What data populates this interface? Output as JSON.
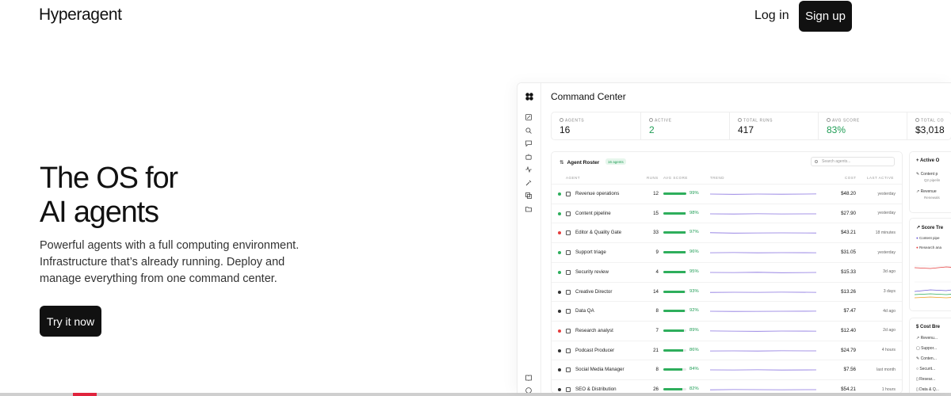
{
  "nav": {
    "logo": "Hyperagent",
    "login": "Log in",
    "signup": "Sign up"
  },
  "hero": {
    "title_lines": [
      "The OS for",
      "AI agents"
    ],
    "subtitle_lines": [
      "Powerful agents with a full computing environment.",
      "Infrastructure that’s already running. Deploy and",
      "manage everything from one command center."
    ],
    "cta": "Try it now"
  },
  "app": {
    "title": "Command Center",
    "stats": [
      {
        "label": "AGENTS",
        "value": "16",
        "color": "#111111"
      },
      {
        "label": "ACTIVE",
        "value": "2",
        "color": "#1f9d55"
      },
      {
        "label": "TOTAL RUNS",
        "value": "417",
        "color": "#111111"
      },
      {
        "label": "AVG SCORE",
        "value": "83%",
        "color": "#1f9d55"
      },
      {
        "label": "TOTAL CO",
        "value": "$3,018",
        "color": "#111111"
      }
    ],
    "roster": {
      "title": "Agent Roster",
      "badge": "16 agents",
      "search_placeholder": "Search agents...",
      "columns": [
        "AGENT",
        "RUNS",
        "AVG SCORE",
        "TREND",
        "COST",
        "LAST ACTIVE"
      ],
      "rows": [
        {
          "name": "Revenue operations",
          "runs": "12",
          "score": 99,
          "score_label": "99%",
          "cost": "$48.20",
          "last": "yesterday",
          "status": "#2eae5c",
          "icon": "trend-icon"
        },
        {
          "name": "Content pipeline",
          "runs": "15",
          "score": 98,
          "score_label": "98%",
          "cost": "$27.90",
          "last": "yesterday",
          "status": "#2eae5c",
          "icon": "pencil-icon"
        },
        {
          "name": "Editor & Quality Gate",
          "runs": "33",
          "score": 97,
          "score_label": "97%",
          "cost": "$43.21",
          "last": "18 minutes",
          "status": "#e53e3e",
          "icon": "search-icon"
        },
        {
          "name": "Support triage",
          "runs": "9",
          "score": 96,
          "score_label": "96%",
          "cost": "$31.05",
          "last": "yesterday",
          "status": "#2eae5c",
          "icon": "chat-icon"
        },
        {
          "name": "Security review",
          "runs": "4",
          "score": 95,
          "score_label": "95%",
          "cost": "$15.33",
          "last": "3d ago",
          "status": "#2eae5c",
          "icon": "shield-icon"
        },
        {
          "name": "Creative Director",
          "runs": "14",
          "score": 93,
          "score_label": "93%",
          "cost": "$13.26",
          "last": "3 days",
          "status": "#333333",
          "icon": "chart-icon"
        },
        {
          "name": "Data QA",
          "runs": "8",
          "score": 92,
          "score_label": "92%",
          "cost": "$7.47",
          "last": "4d ago",
          "status": "#333333",
          "icon": "chart-icon"
        },
        {
          "name": "Research analyst",
          "runs": "7",
          "score": 89,
          "score_label": "89%",
          "cost": "$12.40",
          "last": "2d ago",
          "status": "#e53e3e",
          "icon": "chart-icon"
        },
        {
          "name": "Podcast Producer",
          "runs": "21",
          "score": 86,
          "score_label": "86%",
          "cost": "$24.79",
          "last": "4 hours",
          "status": "#333333",
          "icon": "chart-icon"
        },
        {
          "name": "Social Media Manager",
          "runs": "8",
          "score": 84,
          "score_label": "84%",
          "cost": "$7.56",
          "last": "last month",
          "status": "#333333",
          "icon": "chart-icon"
        },
        {
          "name": "SEO & Distribution",
          "runs": "26",
          "score": 82,
          "score_label": "82%",
          "cost": "$54.21",
          "last": "1 hours",
          "status": "#333333",
          "icon": "chart-icon"
        }
      ]
    },
    "side": {
      "active": {
        "title": "Active O",
        "items": [
          {
            "label": "Content p",
            "sub": "Q2 pipelin"
          },
          {
            "label": "Revenue",
            "sub": "Renewals"
          }
        ]
      },
      "score": {
        "title": "Score Tre",
        "legend": [
          "Content pipe",
          "Research ana"
        ]
      },
      "cost": {
        "title": "Cost Bre",
        "items": [
          "Revenu...",
          "Suppor...",
          "Conten...",
          "Securit...",
          "Resear...",
          "Data & Q..."
        ]
      }
    }
  }
}
